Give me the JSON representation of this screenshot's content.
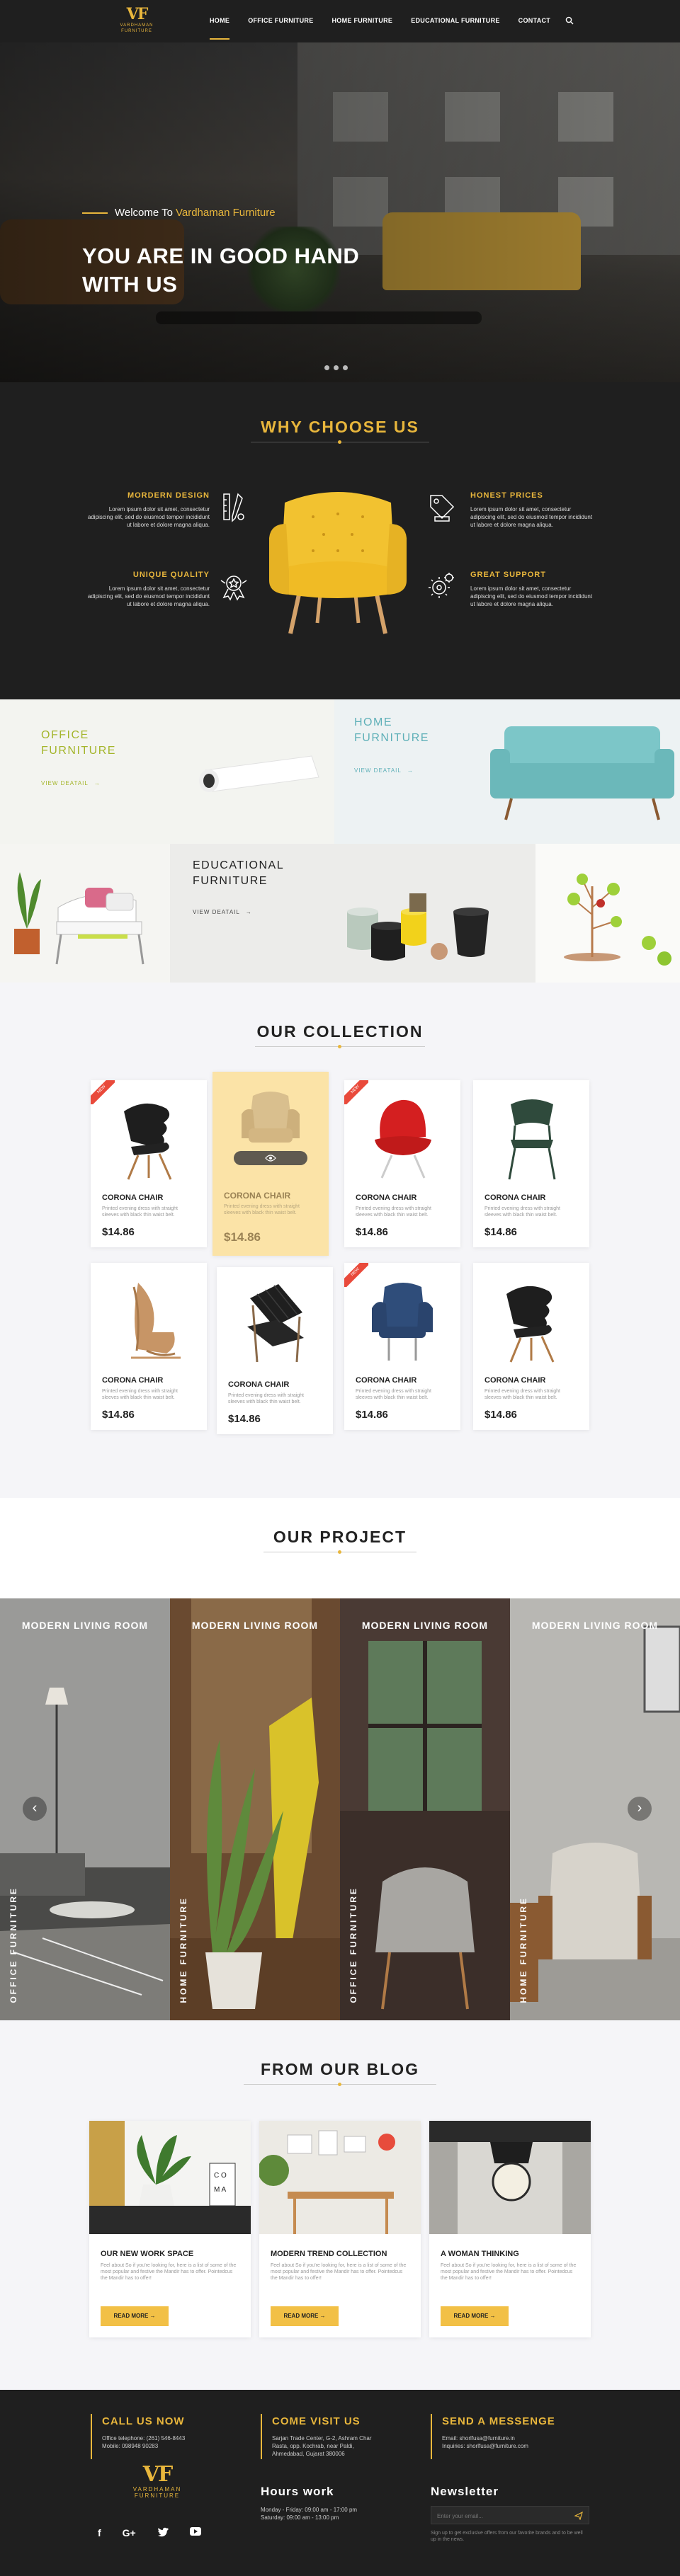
{
  "brand": {
    "mark": "VF",
    "name": "VARDHAMAN",
    "tag": "FURNITURE"
  },
  "nav": {
    "items": [
      "HOME",
      "OFFICE FURNITURE",
      "HOME FURNITURE",
      "EDUCATIONAL FURNITURE",
      "CONTACT"
    ],
    "active": "HOME"
  },
  "hero": {
    "welcome_prefix": "Welcome To",
    "welcome_brand": "Vardhaman Furniture",
    "headline": "YOU ARE IN GOOD HAND WITH US"
  },
  "why": {
    "title": "WHY CHOOSE US",
    "features": [
      {
        "title": "MORDERN DESIGN",
        "text": "Lorem ipsum dolor sit amet, consectetur adipiscing elit, sed do eiusmod tempor incididunt ut labore et dolore magna aliqua.",
        "icon": "pen-ruler-icon"
      },
      {
        "title": "HONEST PRICES",
        "text": "Lorem ipsum dolor sit amet, consectetur adipiscing elit, sed do eiusmod tempor incididunt ut labore et dolore magna aliqua.",
        "icon": "price-tag-icon"
      },
      {
        "title": "UNIQUE QUALITY",
        "text": "Lorem ipsum dolor sit amet, consectetur adipiscing elit, sed do eiusmod tempor incididunt ut labore et dolore magna aliqua.",
        "icon": "quality-badge-icon"
      },
      {
        "title": "GREAT SUPPORT",
        "text": "Lorem ipsum dolor sit amet, consectetur adipiscing elit, sed do eiusmod tempor incididunt ut labore et dolore magna aliqua.",
        "icon": "support-gear-icon"
      }
    ]
  },
  "categories": {
    "office": {
      "line1": "OFFICE",
      "line2": "FURNITURE",
      "link": "VIEW DEATAIL"
    },
    "home": {
      "line1": "HOME",
      "line2": "FURNITURE",
      "link": "VIEW DEATAIL"
    },
    "edu": {
      "line1": "EDUCATIONAL",
      "line2": "FURNITURE",
      "link": "VIEW DEATAIL"
    }
  },
  "collection": {
    "title": "OUR COLLECTION",
    "badge": "NEW",
    "products": [
      {
        "name": "CORONA CHAIR",
        "desc": "Printed evening dress with straight sleeves with black thin waist belt.",
        "price": "$14.86"
      },
      {
        "name": "CORONA CHAIR",
        "desc": "Printed evening dress with straight sleeves with black thin waist belt.",
        "price": "$14.86"
      },
      {
        "name": "CORONA CHAIR",
        "desc": "Printed evening dress with straight sleeves with black thin waist belt.",
        "price": "$14.86"
      },
      {
        "name": "CORONA CHAIR",
        "desc": "Printed evening dress with straight sleeves with black thin waist belt.",
        "price": "$14.86"
      },
      {
        "name": "CORONA CHAIR",
        "desc": "Printed evening dress with straight sleeves with black thin waist belt.",
        "price": "$14.86"
      },
      {
        "name": "CORONA CHAIR",
        "desc": "Printed evening dress with straight sleeves with black thin waist belt.",
        "price": "$14.86"
      },
      {
        "name": "CORONA CHAIR",
        "desc": "Printed evening dress with straight sleeves with black thin waist belt.",
        "price": "$14.86"
      },
      {
        "name": "CORONA CHAIR",
        "desc": "Printed evening dress with straight sleeves with black thin waist belt.",
        "price": "$14.86"
      }
    ]
  },
  "project": {
    "title": "OUR PROJECT",
    "panels": [
      {
        "label": "MODERN LIVING ROOM",
        "vertical": "OFFICE FURNITURE"
      },
      {
        "label": "MODERN LIVING ROOM",
        "vertical": "HOME FURNITURE"
      },
      {
        "label": "MODERN LIVING ROOM",
        "vertical": "OFFICE FURNITURE"
      },
      {
        "label": "MODERN LIVING ROOM",
        "vertical": "HOME FURNITURE"
      }
    ]
  },
  "blog": {
    "title": "FROM OUR BLOG",
    "read_more": "READ MORE",
    "posts": [
      {
        "title": "OUR NEW WORK SPACE",
        "text": "Feel about So if you're looking for, here is a list of some of the most popular and festive the Mandir has to offer. Pointedcus the Mandir has to offer!"
      },
      {
        "title": "MODERN TREND COLLECTION",
        "text": "Feel about So if you're looking for, here is a list of some of the most popular and festive the Mandir has to offer. Pointedcus the Mandir has to offer!"
      },
      {
        "title": "A WOMAN THINKING",
        "text": "Feel about So if you're looking for, here is a list of some of the most popular and festive the Mandir has to offer. Pointedcus the Mandir has to offer!"
      }
    ]
  },
  "footer": {
    "call": {
      "title": "CALL US NOW",
      "line1": "Office telephone: (261) 546-8443",
      "line2": "Mobile: 098948 90283"
    },
    "visit": {
      "title": "COME VISIT US",
      "line1": "Sarjan Trade Center, G-2, Ashram Char",
      "line2": "Rasta, opp. Kochrab, near Paldi,",
      "line3": "Ahmedabad, Gujarat 380006"
    },
    "send": {
      "title": "SEND A MESSENGE",
      "line1": "Email: shorlfusa@furniture.in",
      "line2": "Inquiries: shorlfusa@furniture.com"
    },
    "hours": {
      "title": "Hours work",
      "line1": "Monday - Friday: 09:00 am - 17:00 pm",
      "line2": "Saturday: 09:00 am - 13:00 pm"
    },
    "newsletter": {
      "title": "Newsletter",
      "placeholder": "Enter your email...",
      "note": "Sign up to get exclusive offers from our favorite brands and to be well up in the news."
    }
  },
  "colors": {
    "gold": "#e8b63c",
    "dark": "#1f1f1f",
    "teal": "#5fb0b8",
    "olive": "#a4b52b",
    "yellow": "#f2c046"
  }
}
